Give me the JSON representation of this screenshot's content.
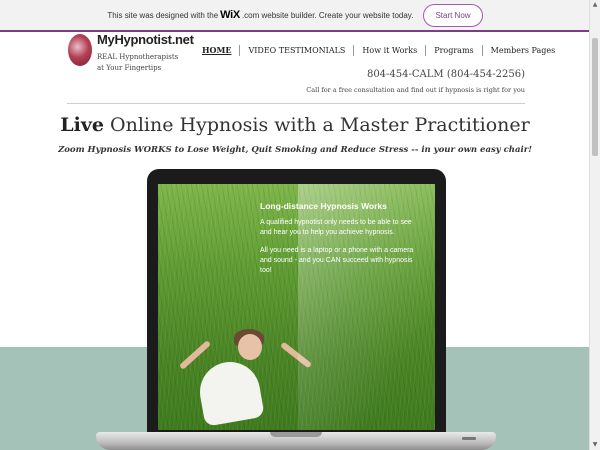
{
  "wix_banner": {
    "text_before": "This site was designed with the",
    "brand": "WiX",
    "text_after": ".com website builder. Create your website today.",
    "cta": "Start Now"
  },
  "header": {
    "logo_title": "MyHypnotist.net",
    "logo_tagline": "REAL Hypnotherapists at Your Fingertips",
    "phone": "804-454-CALM  (804-454-2256)",
    "consult_text": "Call for a free consultation and find out if hypnosis is right for you"
  },
  "nav": {
    "items": [
      {
        "label": "HOME"
      },
      {
        "label": "VIDEO TESTIMONIALS"
      },
      {
        "label": "How it Works"
      },
      {
        "label": "Programs"
      },
      {
        "label": "Members Pages"
      }
    ],
    "active_index": 0
  },
  "hero": {
    "headline_strong": "Live",
    "headline_rest": " Online Hypnosis with a Master Practitioner",
    "subheadline": "Zoom Hypnosis WORKS to Lose Weight, Quit Smoking and Reduce Stress -- in your own easy chair!"
  },
  "laptop_screen": {
    "title": "Long-distance Hypnosis Works",
    "para1": "A qualified hypnotist only needs to be able to see and hear you to help you achieve hypnosis.",
    "para2": "All you need is a laptop or a phone with a camera and sound - and you CAN succeed with hypnosis too!"
  },
  "colors": {
    "accent": "#7c3d86",
    "band": "#a5c2b8"
  }
}
